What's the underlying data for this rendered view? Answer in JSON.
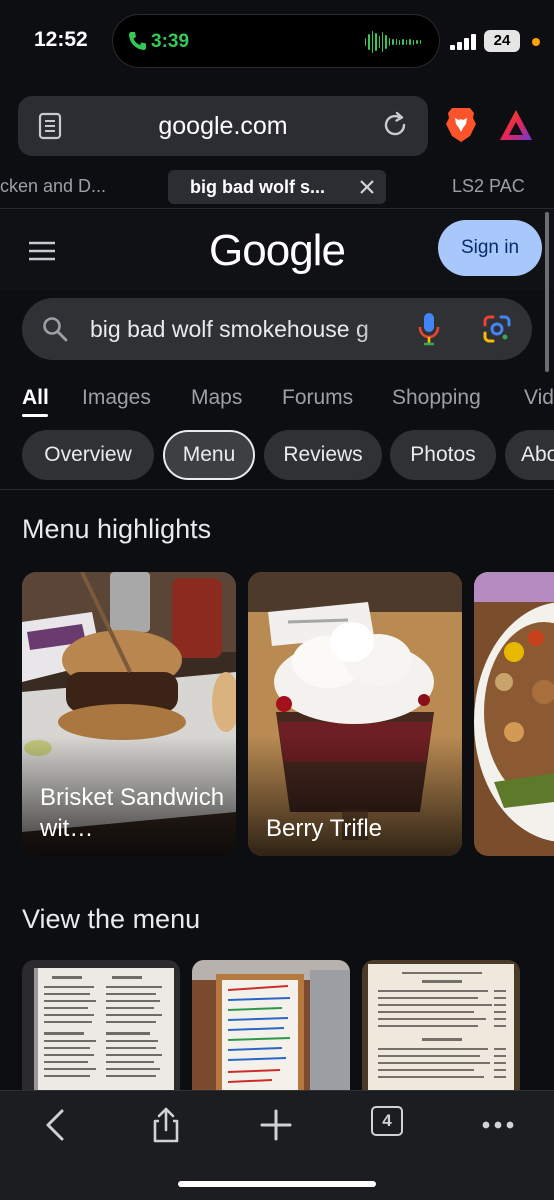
{
  "status_bar": {
    "time": "12:52",
    "call_time": "3:39",
    "battery": "24"
  },
  "browser": {
    "url": "google.com",
    "tabs": [
      {
        "label": "cken and D..."
      },
      {
        "label": "big bad wolf s..."
      },
      {
        "label": "LS2 PAC"
      }
    ],
    "tab_count": "4"
  },
  "google": {
    "logo": "Google",
    "sign_in": "Sign in",
    "query": "big bad wolf smokehouse g",
    "filter_tabs": [
      "All",
      "Images",
      "Maps",
      "Forums",
      "Shopping",
      "Vid"
    ],
    "active_filter": "All",
    "chips": [
      "Overview",
      "Menu",
      "Reviews",
      "Photos",
      "Abo"
    ],
    "selected_chip": "Menu"
  },
  "menu_highlights": {
    "heading": "Menu highlights",
    "items": [
      {
        "label": "Brisket Sandwich wit…"
      },
      {
        "label": "Berry Trifle"
      },
      {
        "label": ""
      }
    ]
  },
  "view_menu": {
    "heading": "View the menu"
  },
  "colors": {
    "accent_signin": "#a8c7fa",
    "call_green": "#34c759",
    "background": "#0d0e12"
  }
}
